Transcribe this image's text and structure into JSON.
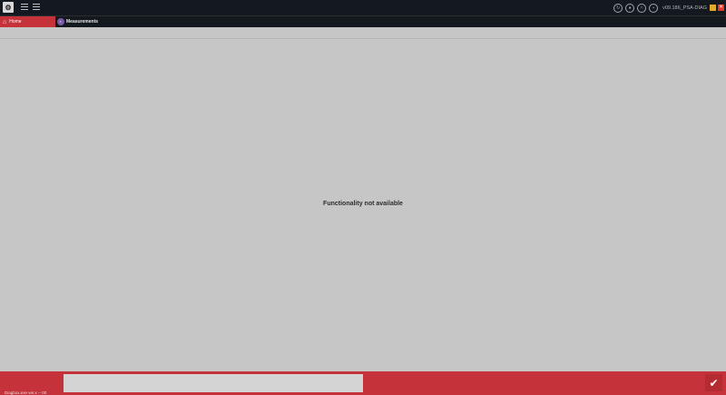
{
  "topbar": {
    "version_text": "v09.186_PSA-DIAG",
    "icons": [
      "refresh-icon",
      "user-icon",
      "wifi-icon",
      "lock-icon",
      "minimize-icon",
      "close-icon"
    ]
  },
  "tabs": {
    "home_label": "Home",
    "measurements_label": "Measurements"
  },
  "main": {
    "message": "Functionality not available"
  },
  "bottom": {
    "status_text": "Diagbox.exe  ver.x -- 00"
  },
  "colors": {
    "accent": "#c5323a",
    "titlebar": "#13191e",
    "background": "#c6c6c6"
  }
}
